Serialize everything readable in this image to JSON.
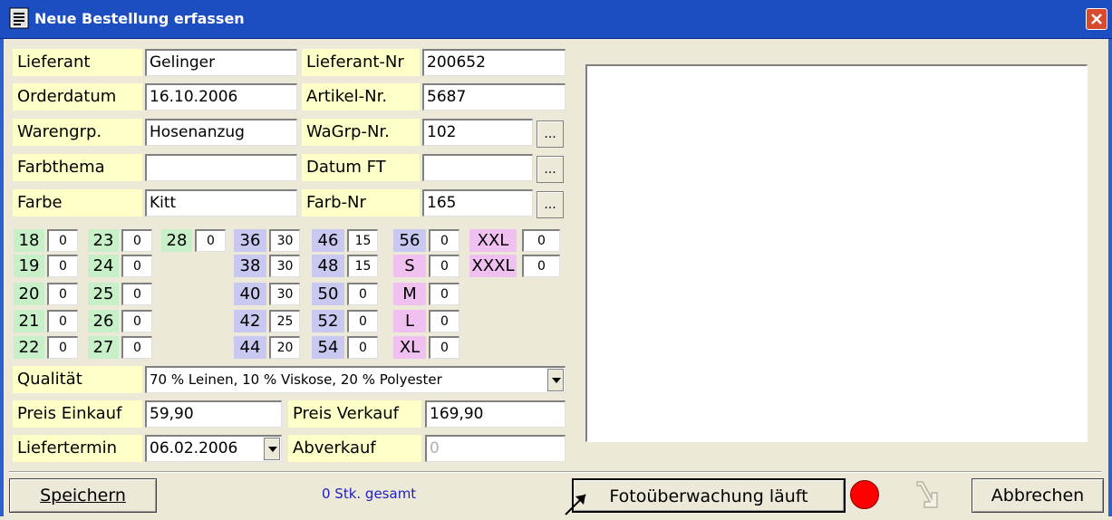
{
  "window": {
    "title": "Neue Bestellung erfassen"
  },
  "form": {
    "lieferant": {
      "label": "Lieferant",
      "value": "Gelinger"
    },
    "lieferant_nr": {
      "label": "Lieferant-Nr",
      "value": "200652"
    },
    "orderdatum": {
      "label": "Orderdatum",
      "value": "16.10.2006"
    },
    "artikel_nr": {
      "label": "Artikel-Nr.",
      "value": "5687"
    },
    "warengrp": {
      "label": "Warengrp.",
      "value": "Hosenanzug"
    },
    "wagrp_nr": {
      "label": "WaGrp-Nr.",
      "value": "102"
    },
    "farbthema": {
      "label": "Farbthema",
      "value": ""
    },
    "datum_ft": {
      "label": "Datum FT",
      "value": ""
    },
    "farbe": {
      "label": "Farbe",
      "value": "Kitt"
    },
    "farb_nr": {
      "label": "Farb-Nr",
      "value": "165"
    },
    "dots_label": "..."
  },
  "sizes": [
    {
      "size": "18",
      "qty": "0",
      "color": "green"
    },
    {
      "size": "19",
      "qty": "0",
      "color": "green"
    },
    {
      "size": "20",
      "qty": "0",
      "color": "green"
    },
    {
      "size": "21",
      "qty": "0",
      "color": "green"
    },
    {
      "size": "22",
      "qty": "0",
      "color": "green"
    },
    {
      "size": "23",
      "qty": "0",
      "color": "green"
    },
    {
      "size": "24",
      "qty": "0",
      "color": "green"
    },
    {
      "size": "25",
      "qty": "0",
      "color": "green"
    },
    {
      "size": "26",
      "qty": "0",
      "color": "green"
    },
    {
      "size": "27",
      "qty": "0",
      "color": "green"
    },
    {
      "size": "28",
      "qty": "0",
      "color": "green"
    },
    {
      "size": "36",
      "qty": "30",
      "color": "blue"
    },
    {
      "size": "38",
      "qty": "30",
      "color": "blue"
    },
    {
      "size": "40",
      "qty": "30",
      "color": "blue"
    },
    {
      "size": "42",
      "qty": "25",
      "color": "blue"
    },
    {
      "size": "44",
      "qty": "20",
      "color": "blue"
    },
    {
      "size": "46",
      "qty": "15",
      "color": "blue"
    },
    {
      "size": "48",
      "qty": "15",
      "color": "blue"
    },
    {
      "size": "50",
      "qty": "0",
      "color": "blue"
    },
    {
      "size": "52",
      "qty": "0",
      "color": "blue"
    },
    {
      "size": "54",
      "qty": "0",
      "color": "blue"
    },
    {
      "size": "56",
      "qty": "0",
      "color": "blue"
    },
    {
      "size": "S",
      "qty": "0",
      "color": "pink"
    },
    {
      "size": "M",
      "qty": "0",
      "color": "pink"
    },
    {
      "size": "L",
      "qty": "0",
      "color": "pink"
    },
    {
      "size": "XL",
      "qty": "0",
      "color": "pink"
    },
    {
      "size": "XXL",
      "qty": "0",
      "color": "pink"
    },
    {
      "size": "XXXL",
      "qty": "0",
      "color": "pink"
    }
  ],
  "qualitaet": {
    "label": "Qualität",
    "value": "70 % Leinen, 10 % Viskose, 20 % Polyester"
  },
  "preis_einkauf": {
    "label": "Preis Einkauf",
    "value": "59,90"
  },
  "preis_verkauf": {
    "label": "Preis Verkauf",
    "value": "169,90"
  },
  "liefertermin": {
    "label": "Liefertermin",
    "value": "06.02.2006"
  },
  "abverkauf": {
    "label": "Abverkauf",
    "value": "0"
  },
  "footer": {
    "save_label": "Speichern",
    "total_text": "0 Stk. gesamt",
    "photo_button_label": "Fotoüberwachung läuft",
    "cancel_label": "Abbrechen"
  },
  "colors": {
    "titlebar": "#1d4ec1",
    "label_bg": "#ffffc8",
    "size_green": "#c8f0c8",
    "size_blue": "#c8c8f0",
    "size_pink": "#f0c0f0",
    "status_indicator": "#ff0000",
    "total_text": "#2020c0"
  }
}
